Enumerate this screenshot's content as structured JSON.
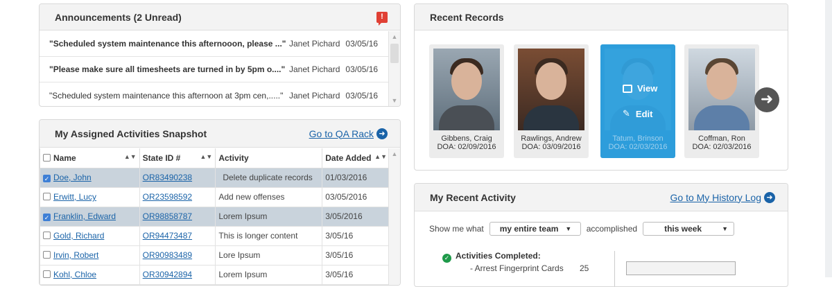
{
  "announcements": {
    "title": "Announcements (2 Unread)",
    "flag_icon": "!",
    "items": [
      {
        "message": "\"Scheduled system maintenance this afternooon, please ...\"",
        "author": "Janet Pichard",
        "date": "03/05/16",
        "unread": true
      },
      {
        "message": "\"Please make sure all timesheets are turned in by 5pm o....\"",
        "author": "Janet Pichard",
        "date": "03/05/16",
        "unread": true
      },
      {
        "message": "\"Scheduled system maintenance this afternoon at 3pm cen,.....\"",
        "author": "Janet Pichard",
        "date": "03/05/16",
        "unread": false
      }
    ]
  },
  "activities": {
    "title": "My Assigned Activities Snapshot",
    "link": "Go to QA Rack",
    "columns": [
      "Name",
      "State ID #",
      "Activity",
      "Date Added"
    ],
    "rows": [
      {
        "name": "Doe, John",
        "state_id": "OR83490238",
        "activity": "Delete duplicate records",
        "date": "01/03/2016",
        "selected": true
      },
      {
        "name": "Erwitt, Lucy",
        "state_id": "OR23598592",
        "activity": "Add new offenses",
        "date": "03/05/2016",
        "selected": false
      },
      {
        "name": "Franklin, Edward",
        "state_id": "OR98858787",
        "activity": "Lorem Ipsum",
        "date": "3/05/2016",
        "selected": true
      },
      {
        "name": "Gold, Richard",
        "state_id": "OR94473487",
        "activity": "This is longer content",
        "date": "3/05/16",
        "selected": false
      },
      {
        "name": "Irvin, Robert",
        "state_id": "OR90983489",
        "activity": "Lore Ipsum",
        "date": "3/05/16",
        "selected": false
      },
      {
        "name": "Kohl, Chloe",
        "state_id": "OR30942894",
        "activity": "Lorem Ipsum",
        "date": "3/05/16",
        "selected": false
      }
    ]
  },
  "records": {
    "title": "Recent Records",
    "view_label": "View",
    "edit_label": "Edit",
    "cards": [
      {
        "name": "Gibbens, Craig",
        "doa": "DOA: 02/09/2016"
      },
      {
        "name": "Rawlings, Andrew",
        "doa": "DOA: 03/09/2016"
      },
      {
        "name": "Tatum, Brinson",
        "doa": "DOA: 02/03/2016"
      },
      {
        "name": "Coffman, Ron",
        "doa": "DOA: 02/03/2016"
      }
    ]
  },
  "recent_activity": {
    "title": "My Recent Activity",
    "link": "Go to My History Log",
    "show_prefix": "Show me what",
    "team_select": "my entire team",
    "accomplished": "accomplished",
    "period_select": "this week",
    "completed_label": "Activities Completed:",
    "items": [
      {
        "label": "- Arrest Fingerprint Cards",
        "count": "25"
      }
    ]
  },
  "colors": {
    "accent": "#1a63a8",
    "active_card": "#2d9ddb",
    "selected_row": "#c9d3dc",
    "flag": "#e04034"
  }
}
